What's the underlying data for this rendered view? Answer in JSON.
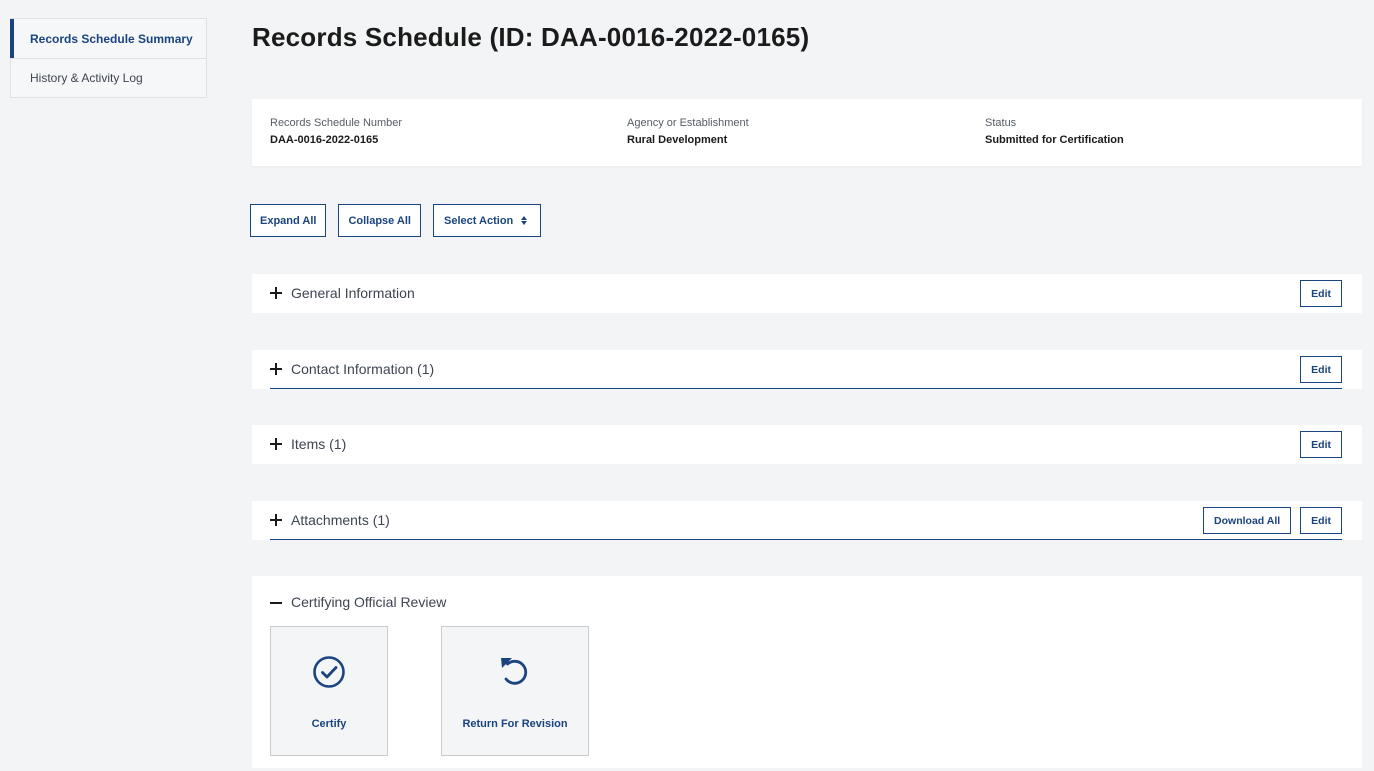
{
  "sidebar": {
    "items": [
      {
        "label": "Records Schedule Summary",
        "active": true
      },
      {
        "label": "History & Activity Log",
        "active": false
      }
    ]
  },
  "page": {
    "title": "Records Schedule (ID: DAA-0016-2022-0165)"
  },
  "summary": {
    "schedule_number_label": "Records Schedule Number",
    "schedule_number_value": "DAA-0016-2022-0165",
    "agency_label": "Agency or Establishment",
    "agency_value": "Rural Development",
    "status_label": "Status",
    "status_value": "Submitted for Certification"
  },
  "toolbar": {
    "expand_all": "Expand All",
    "collapse_all": "Collapse All",
    "select_action": "Select Action"
  },
  "sections": {
    "general": {
      "label": "General Information",
      "edit": "Edit"
    },
    "contact": {
      "label": "Contact Information (1)",
      "edit": "Edit"
    },
    "items": {
      "label": "Items (1)",
      "edit": "Edit"
    },
    "attachments": {
      "label": "Attachments (1)",
      "download_all": "Download All",
      "edit": "Edit"
    }
  },
  "review": {
    "title": "Certifying Official Review",
    "certify_label": "Certify",
    "return_label": "Return For Revision",
    "certify_icon": "check-circle-icon",
    "return_icon": "undo-icon"
  },
  "colors": {
    "primary": "#1a4480",
    "background": "#f3f4f5",
    "card": "#ffffff"
  }
}
